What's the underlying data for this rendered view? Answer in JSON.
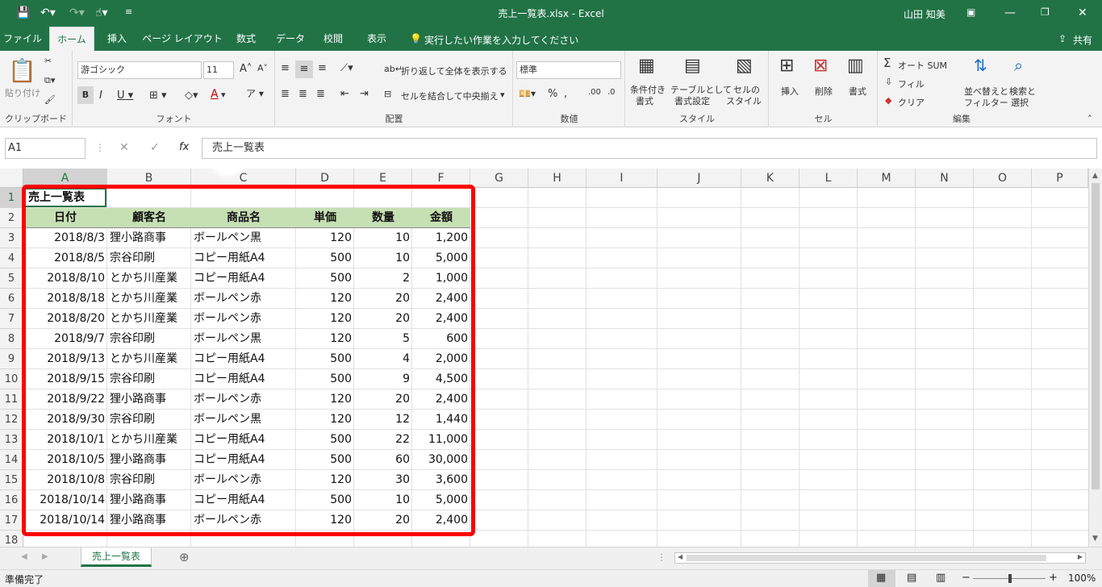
{
  "titlebar": {
    "title": "売上一覧表.xlsx  -  Excel",
    "user": "山田 知美"
  },
  "tabs": [
    "ファイル",
    "ホーム",
    "挿入",
    "ページ レイアウト",
    "数式",
    "データ",
    "校閲",
    "表示"
  ],
  "tell_me": "実行したい作業を入力してください",
  "share": "共有",
  "ribbon": {
    "clipboard": {
      "paste": "貼り付け",
      "label": "クリップボード"
    },
    "font": {
      "name": "游ゴシック",
      "size": "11",
      "label": "フォント"
    },
    "alignment": {
      "wrap": "折り返して全体を表示する",
      "merge": "セルを結合して中央揃え",
      "label": "配置"
    },
    "number": {
      "format": "標準",
      "label": "数値"
    },
    "style": {
      "cond_line1": "条件付き",
      "cond_line2": "書式",
      "table_line1": "テーブルとして",
      "table_line2": "書式設定",
      "cellstyle_line1": "セルの",
      "cellstyle_line2": "スタイル",
      "label": "スタイル"
    },
    "cells": {
      "insert": "挿入",
      "delete": "削除",
      "format": "書式",
      "label": "セル"
    },
    "editing": {
      "autosum": "オート SUM",
      "fill": "フィル",
      "clear": "クリア",
      "sort_line1": "並べ替えと",
      "sort_line2": "フィルター",
      "find_line1": "検索と",
      "find_line2": "選択",
      "label": "編集"
    }
  },
  "formula_bar": {
    "namebox": "A1",
    "fx": "fx",
    "content": "売上一覧表"
  },
  "annotation": {
    "marker": "①",
    "color": "#ff0000"
  },
  "columns": [
    "A",
    "B",
    "C",
    "D",
    "E",
    "F",
    "G",
    "H",
    "I",
    "J",
    "K",
    "L",
    "M",
    "N",
    "O",
    "P"
  ],
  "rows": [
    "1",
    "2",
    "3",
    "4",
    "5",
    "6",
    "7",
    "8",
    "9",
    "10",
    "11",
    "12",
    "13",
    "14",
    "15",
    "16",
    "17",
    "18"
  ],
  "table": {
    "title": "売上一覧表",
    "headers": [
      "日付",
      "顧客名",
      "商品名",
      "単価",
      "数量",
      "金額"
    ],
    "header_fill": "#c6e0b4",
    "data": [
      [
        "2018/8/3",
        "狸小路商事",
        "ボールペン黒",
        "120",
        "10",
        "1,200"
      ],
      [
        "2018/8/5",
        "宗谷印刷",
        "コピー用紙A4",
        "500",
        "10",
        "5,000"
      ],
      [
        "2018/8/10",
        "とかち川産業",
        "コピー用紙A4",
        "500",
        "2",
        "1,000"
      ],
      [
        "2018/8/18",
        "とかち川産業",
        "ボールペン赤",
        "120",
        "20",
        "2,400"
      ],
      [
        "2018/8/20",
        "とかち川産業",
        "ボールペン赤",
        "120",
        "20",
        "2,400"
      ],
      [
        "2018/9/7",
        "宗谷印刷",
        "ボールペン黒",
        "120",
        "5",
        "600"
      ],
      [
        "2018/9/13",
        "とかち川産業",
        "コピー用紙A4",
        "500",
        "4",
        "2,000"
      ],
      [
        "2018/9/15",
        "宗谷印刷",
        "コピー用紙A4",
        "500",
        "9",
        "4,500"
      ],
      [
        "2018/9/22",
        "狸小路商事",
        "ボールペン赤",
        "120",
        "20",
        "2,400"
      ],
      [
        "2018/9/30",
        "宗谷印刷",
        "ボールペン黒",
        "120",
        "12",
        "1,440"
      ],
      [
        "2018/10/1",
        "とかち川産業",
        "コピー用紙A4",
        "500",
        "22",
        "11,000"
      ],
      [
        "2018/10/5",
        "狸小路商事",
        "コピー用紙A4",
        "500",
        "60",
        "30,000"
      ],
      [
        "2018/10/8",
        "宗谷印刷",
        "ボールペン赤",
        "120",
        "30",
        "3,600"
      ],
      [
        "2018/10/14",
        "狸小路商事",
        "コピー用紙A4",
        "500",
        "10",
        "5,000"
      ],
      [
        "2018/10/14",
        "狸小路商事",
        "ボールペン赤",
        "120",
        "20",
        "2,400"
      ]
    ]
  },
  "sheet_tab": "売上一覧表",
  "status": {
    "ready": "準備完了",
    "zoom": "100%"
  },
  "colors": {
    "excel_green": "#217346",
    "annotation_red": "#ff0000"
  }
}
